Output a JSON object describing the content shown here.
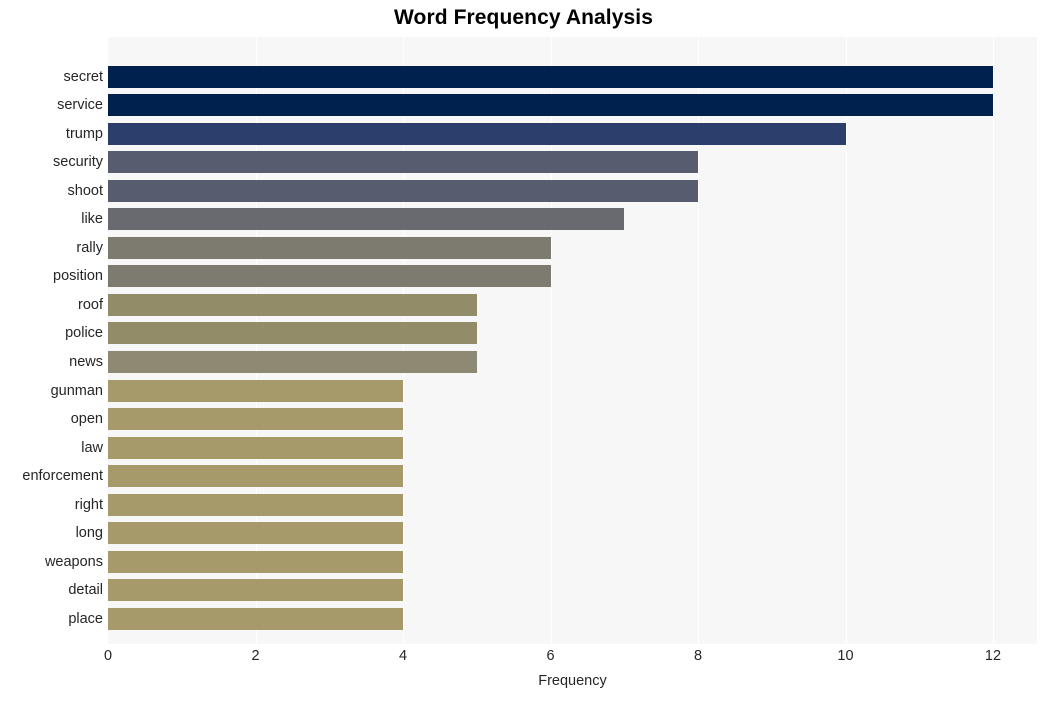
{
  "chart_data": {
    "type": "bar",
    "orientation": "horizontal",
    "title": "Word Frequency Analysis",
    "xlabel": "Frequency",
    "ylabel": "",
    "xlim": [
      0,
      12
    ],
    "xticks": [
      0,
      2,
      4,
      6,
      8,
      10,
      12
    ],
    "xtick_labels": [
      "0",
      "2",
      "4",
      "6",
      "8",
      "10",
      "12"
    ],
    "grid": true,
    "grid_axis": "x",
    "grid_color": "#ffffff",
    "plot_background": "#f7f7f7",
    "legend": false,
    "categories": [
      "secret",
      "service",
      "trump",
      "security",
      "shoot",
      "like",
      "rally",
      "position",
      "roof",
      "police",
      "news",
      "gunman",
      "open",
      "law",
      "enforcement",
      "right",
      "long",
      "weapons",
      "detail",
      "place"
    ],
    "values": [
      12,
      12,
      10,
      8,
      8,
      7,
      6,
      6,
      5,
      5,
      5,
      4,
      4,
      4,
      4,
      4,
      4,
      4,
      4,
      4
    ],
    "bar_colors": [
      "#00204d",
      "#00204d",
      "#2c3e6b",
      "#575c6e",
      "#575c6e",
      "#686a6f",
      "#7d7a6f",
      "#7d7a6f",
      "#928c68",
      "#928c68",
      "#8d8972",
      "#a69a6a",
      "#a69a6a",
      "#a69a6a",
      "#a69a6a",
      "#a69a6a",
      "#a69a6a",
      "#a69a6a",
      "#a69a6a",
      "#a69a6a"
    ]
  }
}
